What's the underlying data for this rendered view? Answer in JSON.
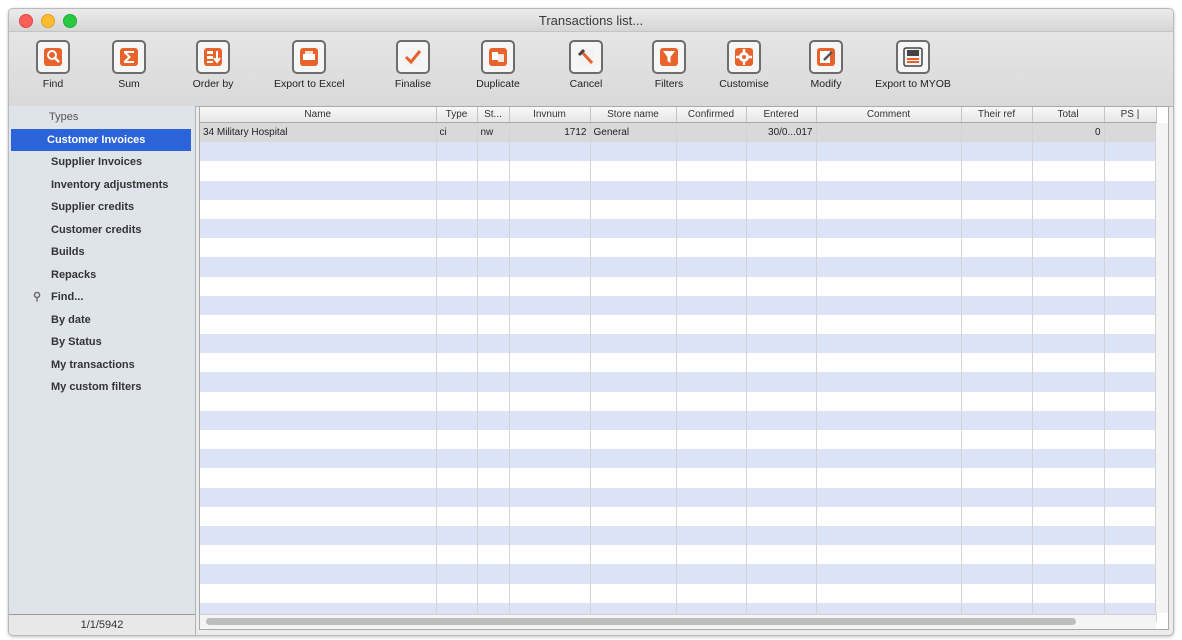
{
  "window": {
    "title": "Transactions list..."
  },
  "toolbar": {
    "items": [
      {
        "label": "Find",
        "icon": "find-icon"
      },
      {
        "label": "Sum",
        "icon": "sum-icon"
      },
      {
        "label": "Order by",
        "icon": "order-by-icon"
      },
      {
        "label": "Export to Excel",
        "icon": "export-excel-icon"
      },
      {
        "label": "Finalise",
        "icon": "finalise-icon"
      },
      {
        "label": "Duplicate",
        "icon": "duplicate-icon"
      },
      {
        "label": "Cancel",
        "icon": "cancel-icon"
      },
      {
        "label": "Filters",
        "icon": "filters-icon"
      },
      {
        "label": "Customise",
        "icon": "customise-icon"
      },
      {
        "label": "Modify",
        "icon": "modify-icon"
      },
      {
        "label": "Export to MYOB",
        "icon": "export-myob-icon"
      }
    ]
  },
  "sidebar": {
    "header": "Types",
    "items": [
      {
        "label": "Customer Invoices",
        "selected": true
      },
      {
        "label": "Supplier Invoices"
      },
      {
        "label": "Inventory adjustments"
      },
      {
        "label": "Supplier credits"
      },
      {
        "label": "Customer credits"
      },
      {
        "label": "Builds"
      },
      {
        "label": "Repacks"
      },
      {
        "label": "Find...",
        "icon": "magnifier-icon"
      },
      {
        "label": "By date"
      },
      {
        "label": "By Status"
      },
      {
        "label": "My transactions"
      },
      {
        "label": "My custom filters"
      }
    ],
    "footer": "1/1/5942"
  },
  "table": {
    "columns": [
      "Name",
      "Type",
      "St...",
      "Invnum",
      "Store name",
      "Confirmed",
      "Entered",
      "Comment",
      "Their ref",
      "Total",
      "PS |"
    ],
    "rows": [
      [
        "34 Military Hospital",
        "ci",
        "nw",
        "1712",
        "General",
        "",
        "30/0...017",
        "",
        "",
        "0",
        ""
      ]
    ]
  },
  "colors": {
    "accent": "#2b63d9",
    "stripe": "#dde3f7",
    "icon_orange": "#e8622c"
  }
}
